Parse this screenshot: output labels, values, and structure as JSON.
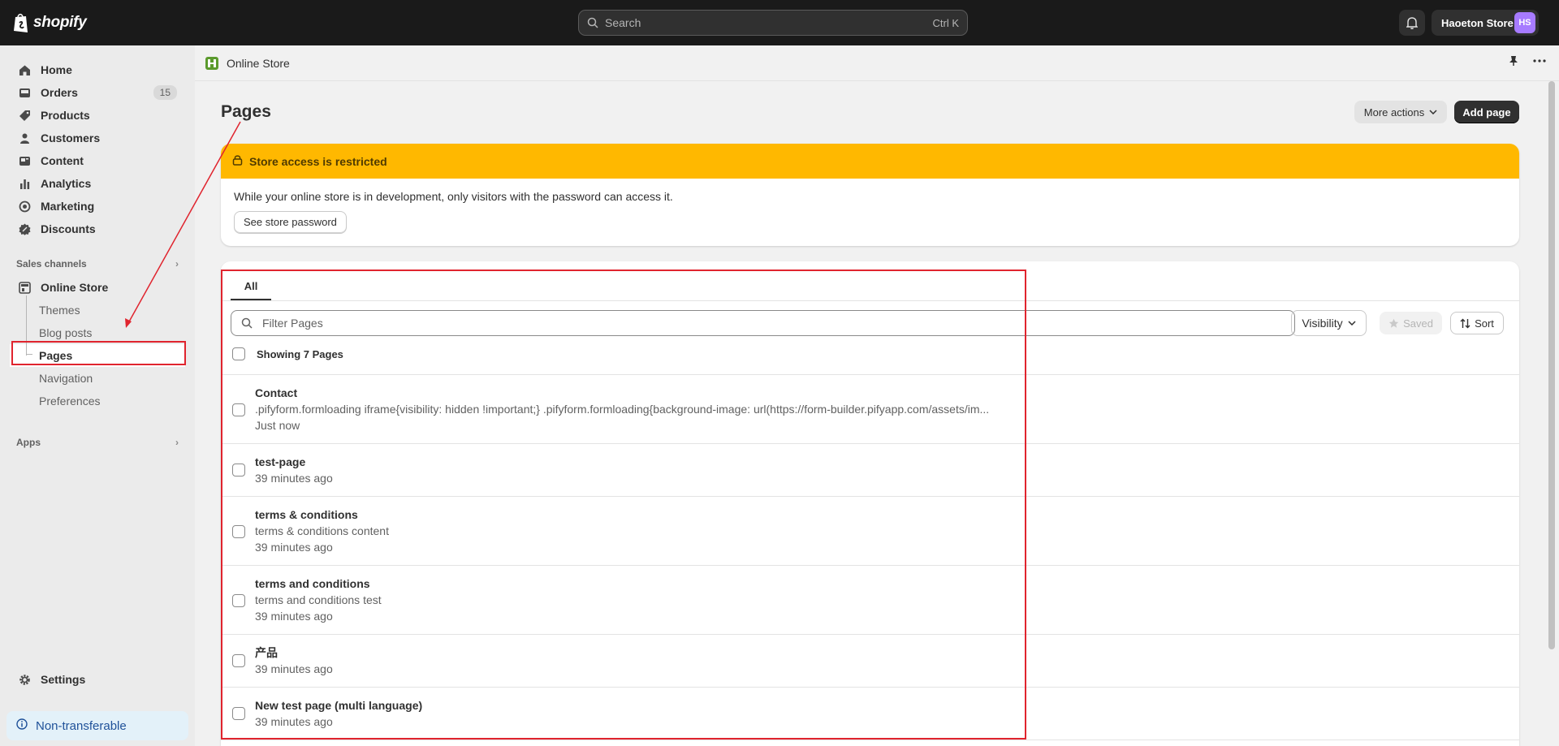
{
  "topbar": {
    "logo_text": "shopify",
    "search_placeholder": "Search",
    "search_shortcut": "Ctrl K",
    "store_name": "Haoeton Store",
    "avatar_initials": "HS"
  },
  "sidebar": {
    "items": [
      {
        "label": "Home",
        "icon": "home-icon"
      },
      {
        "label": "Orders",
        "icon": "orders-icon",
        "badge": "15"
      },
      {
        "label": "Products",
        "icon": "tag-icon"
      },
      {
        "label": "Customers",
        "icon": "person-icon"
      },
      {
        "label": "Content",
        "icon": "content-icon"
      },
      {
        "label": "Analytics",
        "icon": "chart-icon"
      },
      {
        "label": "Marketing",
        "icon": "target-icon"
      },
      {
        "label": "Discounts",
        "icon": "discount-icon"
      }
    ],
    "sales_channels_label": "Sales channels",
    "online_store_label": "Online Store",
    "sub_items": [
      "Themes",
      "Blog posts",
      "Pages",
      "Navigation",
      "Preferences"
    ],
    "apps_label": "Apps",
    "settings_label": "Settings",
    "nontransferable_label": "Non-transferable"
  },
  "breadcrumb": {
    "title": "Online Store"
  },
  "main": {
    "title": "Pages",
    "more_actions_label": "More actions",
    "add_page_label": "Add page",
    "banner": {
      "title": "Store access is restricted",
      "body": "While your online store is in development, only visitors with the password can access it.",
      "button_label": "See store password"
    },
    "tabs": [
      {
        "label": "All"
      }
    ],
    "filter_placeholder": "Filter Pages",
    "visibility_label": "Visibility",
    "saved_label": "Saved",
    "sort_label": "Sort",
    "showing_label": "Showing 7 Pages",
    "pages": [
      {
        "title": "Contact",
        "snippet": ".pifyform.formloading iframe{visibility: hidden !important;} .pifyform.formloading{background-image: url(https://form-builder.pifyapp.com/assets/im...",
        "date": "Just now"
      },
      {
        "title": "test-page",
        "snippet": "",
        "date": "39 minutes ago"
      },
      {
        "title": "terms & conditions",
        "snippet": "terms & conditions content",
        "date": "39 minutes ago"
      },
      {
        "title": "terms and conditions",
        "snippet": "terms and conditions test",
        "date": "39 minutes ago"
      },
      {
        "title": "产品",
        "snippet": "",
        "date": "39 minutes ago"
      },
      {
        "title": "New test page (multi language)",
        "snippet": "",
        "date": "39 minutes ago"
      }
    ]
  },
  "colors": {
    "topbar": "#1a1a1a",
    "banner_warning": "#ffb800",
    "annotation_red": "#e0242e",
    "avatar": "#a77bff"
  }
}
